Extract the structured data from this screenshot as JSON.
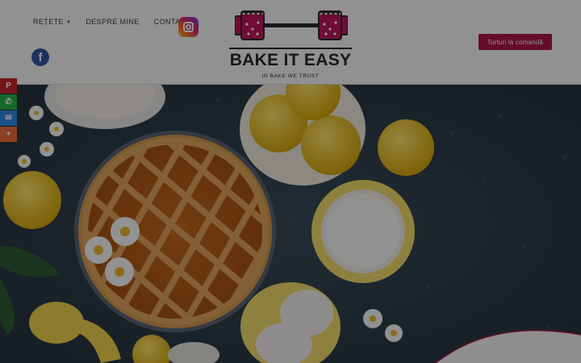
{
  "nav": {
    "items": [
      {
        "label": "REȚETE",
        "has_dropdown": true
      },
      {
        "label": "DESPRE MINE",
        "has_dropdown": false
      },
      {
        "label": "CONTACT",
        "has_dropdown": false
      }
    ],
    "dropdown_caret": "▼"
  },
  "social": {
    "instagram_icon": "instagram-icon",
    "facebook_icon": "facebook-icon",
    "facebook_glyph": "f"
  },
  "logo": {
    "title": "BAKE IT EASY",
    "tagline": "IN BAKE WE TRUST",
    "icon": "cake-dumbbell-icon"
  },
  "cta": {
    "label": "Torturi la comandă"
  },
  "share_bar": [
    {
      "icon": "pinterest-icon",
      "glyph": "P",
      "color": "#c8232c"
    },
    {
      "icon": "whatsapp-icon",
      "glyph": "✆",
      "color": "#25b34a"
    },
    {
      "icon": "messenger-icon",
      "glyph": "✉",
      "color": "#2d8ae8"
    },
    {
      "icon": "more-share-icon",
      "glyph": "+",
      "color": "#f26e3a"
    }
  ],
  "colors": {
    "accent": "#b0154b",
    "header_bg": "#fafafa",
    "hero_bg": "#2f3f4b"
  }
}
